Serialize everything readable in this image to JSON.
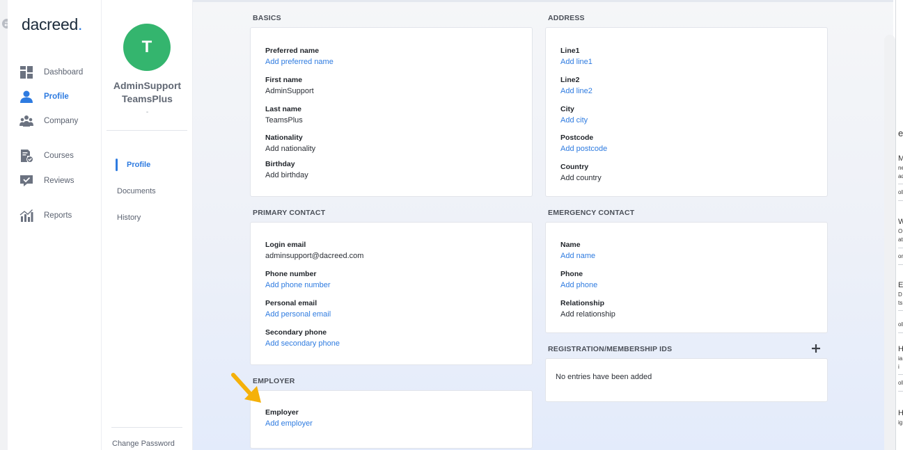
{
  "brand": {
    "name": "dacreed",
    "dot": "."
  },
  "nav": {
    "items": [
      {
        "label": "Dashboard",
        "icon": "dashboard-grid-icon",
        "active": false
      },
      {
        "label": "Profile",
        "icon": "user-icon",
        "active": true
      },
      {
        "label": "Company",
        "icon": "people-group-icon",
        "active": false
      },
      {
        "label": "Courses",
        "icon": "document-check-icon",
        "active": false
      },
      {
        "label": "Reviews",
        "icon": "chat-check-icon",
        "active": false
      },
      {
        "label": "Reports",
        "icon": "chart-bar-icon",
        "active": false
      }
    ]
  },
  "user": {
    "initial": "T",
    "first": "AdminSupport",
    "last": "TeamsPlus",
    "subtitle": "-"
  },
  "subnav": {
    "items": [
      {
        "label": "Profile",
        "active": true
      },
      {
        "label": "Documents",
        "active": false
      },
      {
        "label": "History",
        "active": false
      }
    ],
    "change_password": "Change Password"
  },
  "sections": {
    "basics": {
      "title": "BASICS",
      "fields": [
        {
          "label": "Preferred name",
          "value": "Add preferred name",
          "link": true
        },
        {
          "label": "First name",
          "value": "AdminSupport",
          "link": false
        },
        {
          "label": "Last name",
          "value": "TeamsPlus",
          "link": false
        },
        {
          "label": "Nationality",
          "value": "Add nationality",
          "link": false
        },
        {
          "label": "Birthday",
          "value": "Add birthday",
          "link": false
        }
      ]
    },
    "address": {
      "title": "ADDRESS",
      "fields": [
        {
          "label": "Line1",
          "value": "Add line1",
          "link": true
        },
        {
          "label": "Line2",
          "value": "Add line2",
          "link": true
        },
        {
          "label": "City",
          "value": "Add city",
          "link": true
        },
        {
          "label": "Postcode",
          "value": "Add postcode",
          "link": true
        },
        {
          "label": "Country",
          "value": "Add country",
          "link": false
        }
      ]
    },
    "primary_contact": {
      "title": "PRIMARY CONTACT",
      "fields": [
        {
          "label": "Login email",
          "value": "adminsupport@dacreed.com",
          "link": false
        },
        {
          "label": "Phone number",
          "value": "Add phone number",
          "link": true
        },
        {
          "label": "Personal email",
          "value": "Add personal email",
          "link": true
        },
        {
          "label": "Secondary phone",
          "value": "Add secondary phone",
          "link": true
        }
      ]
    },
    "emergency_contact": {
      "title": "EMERGENCY CONTACT",
      "fields": [
        {
          "label": "Name",
          "value": "Add name",
          "link": true
        },
        {
          "label": "Phone",
          "value": "Add phone",
          "link": true
        },
        {
          "label": "Relationship",
          "value": "Add relationship",
          "link": false
        }
      ]
    },
    "registration": {
      "title": "REGISTRATION/MEMBERSHIP IDS",
      "empty": "No entries have been added"
    },
    "employer": {
      "title": "EMPLOYER",
      "fields": [
        {
          "label": "Employer",
          "value": "Add employer",
          "link": true
        }
      ]
    }
  },
  "right_panel": {
    "fragments": [
      "e",
      "M",
      "ne",
      "ad",
      "oll",
      "W",
      "O",
      "ati",
      "on",
      "E",
      "D",
      "ts",
      "oll",
      "H",
      "ia",
      "i",
      "oll",
      "H",
      "ig"
    ]
  },
  "colors": {
    "accent": "#2e7be0",
    "avatar": "#34b56e",
    "arrow": "#f5b10a"
  }
}
